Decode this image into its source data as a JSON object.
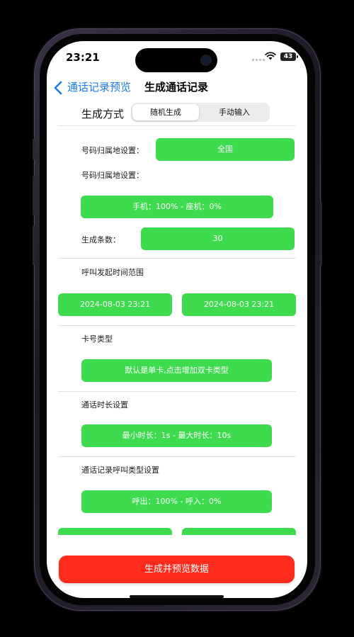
{
  "status_bar": {
    "time": "23:21",
    "battery": "43",
    "wifi_icon": "wifi-icon"
  },
  "nav": {
    "back_label": "通话记录预览",
    "title": "生成通话记录"
  },
  "generation_mode": {
    "label": "生成方式",
    "options": [
      "随机生成",
      "手动输入"
    ],
    "selected": "随机生成"
  },
  "location": {
    "label": "号码归属地设置：",
    "value": "全国"
  },
  "phone_type": {
    "label": "号码归属地设置：",
    "value": "手机：100% - 座机：0%"
  },
  "count": {
    "label": "生成条数：",
    "value": "30"
  },
  "time_range": {
    "label": "呼叫发起时间范围",
    "start": "2024-08-03 23:21",
    "end": "2024-08-03 23:21"
  },
  "sim_type": {
    "label": "卡号类型",
    "value": "默认是单卡,点击增加双卡类型"
  },
  "duration": {
    "label": "通话时长设置",
    "value": "最小时长：1s - 最大时长：10s"
  },
  "call_direction": {
    "label": "通话记录呼叫类型设置",
    "value": "呼出：100% - 呼入：0%"
  },
  "actions": {
    "generate_label": "生成并预览数据"
  },
  "colors": {
    "accent_green": "#3fdb4e",
    "action_red": "#ff2c1e",
    "link_blue": "#1e7be0"
  }
}
